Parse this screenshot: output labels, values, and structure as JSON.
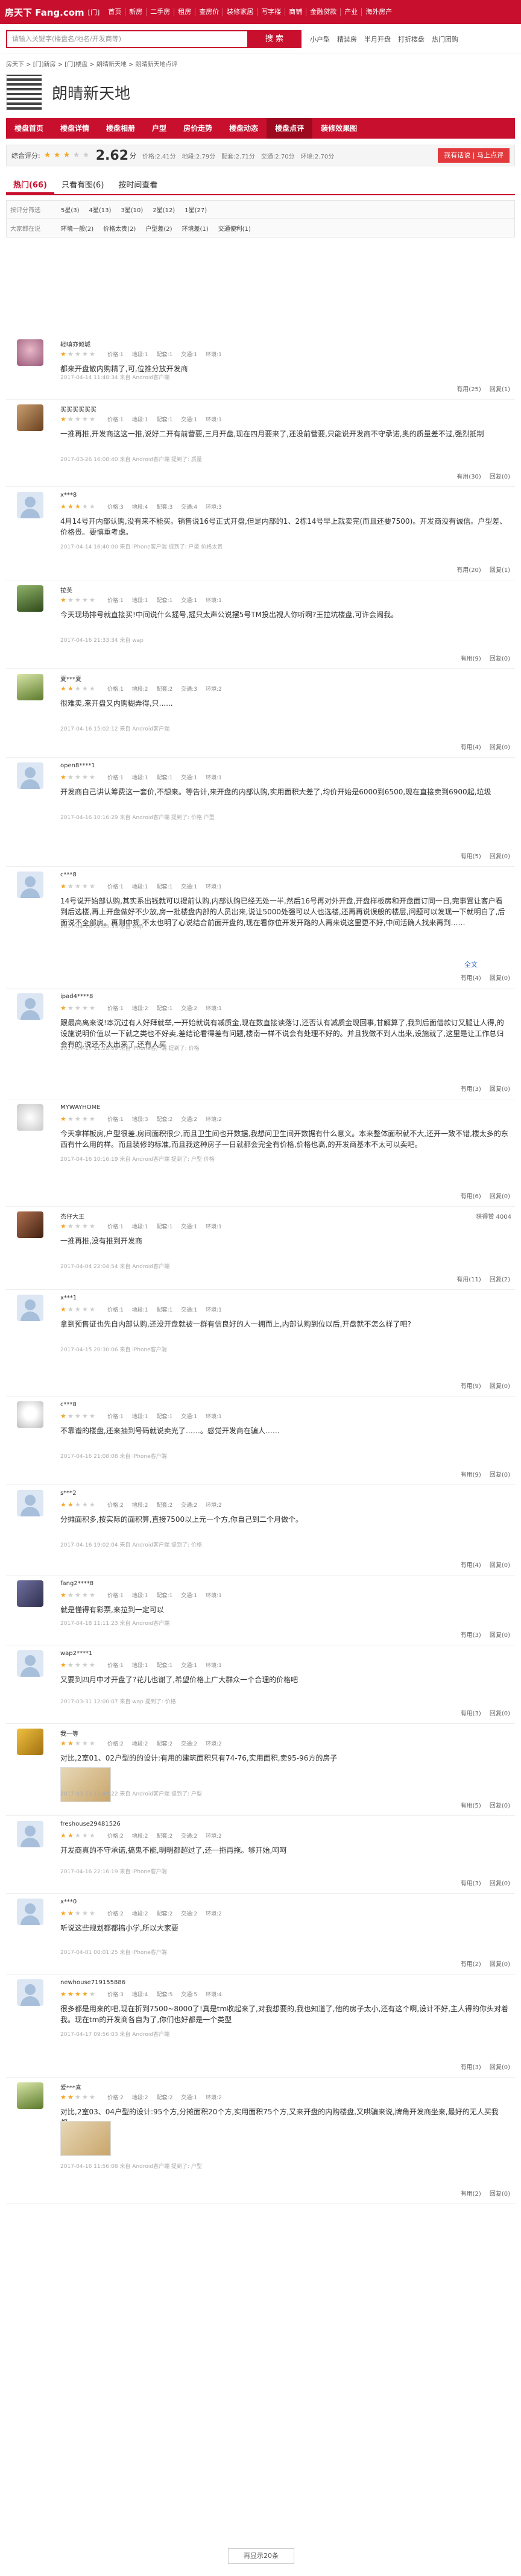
{
  "header": {
    "logo": "房天下 Fang.com",
    "city": "[门]",
    "nav": [
      "首页",
      "新房",
      "二手房",
      "租房",
      "查房价",
      "装修家居",
      "写字楼",
      "商铺",
      "金融贷款",
      "产业",
      "海外房产"
    ]
  },
  "search": {
    "placeholder": "请输入关键字(楼盘名/地名/开发商等)",
    "button": "搜 索",
    "links": [
      "小户型",
      "精装房",
      "半月开盘",
      "打折楼盘",
      "热门团购"
    ]
  },
  "breadcrumb": "房天下 > [门]新房 > [门]楼盘 > 朗晴新天地 > 朗晴新天地点评",
  "project": {
    "title": "朗晴新天地"
  },
  "tabs": [
    "楼盘首页",
    "楼盘详情",
    "楼盘相册",
    "户型",
    "房价走势",
    "楼盘动态",
    "楼盘点评",
    "装修效果图"
  ],
  "rating": {
    "label": "综合评分:",
    "score": "2.62",
    "unit": "分",
    "stars": 3,
    "subs": [
      "价格:2.41分",
      "地段:2.79分",
      "配套:2.71分",
      "交通:2.70分",
      "环境:2.70分"
    ],
    "button": "我有话说",
    "button_sub": "马上点评"
  },
  "filter_tabs": [
    "热门(66)",
    "只看有图(6)",
    "按时间查看"
  ],
  "filters": [
    {
      "label": "按评分筛选",
      "items": [
        "5星(3)",
        "4星(13)",
        "3星(10)",
        "2星(12)",
        "1星(27)"
      ]
    },
    {
      "label": "大家都在说",
      "items": [
        "环境一般(2)",
        "价格太贵(2)",
        "户型差(2)",
        "环境差(1)",
        "交通便利(1)"
      ]
    }
  ],
  "reviews": [
    {
      "name": "轻嗔亦倾城",
      "stars": 1,
      "subs": [
        "价格:1",
        "地段:1",
        "配套:1",
        "交通:1",
        "环境:1"
      ],
      "text": "都来开盘散内购精了,可,位推分放开发商",
      "meta": "2017-04-14 11:48:34   来自 Android客户端",
      "useful": "有用(25)",
      "reply": "回复(1)"
    },
    {
      "name": "买买买买买买",
      "stars": 1,
      "subs": [
        "价格:1",
        "地段:1",
        "配套:1",
        "交通:1",
        "环境:1"
      ],
      "text": "一推再推,开发商这这一推,说好二开有前营要,三月开盘,现在四月要来了,还没前营要,只能说开发商不守承诺,奥的质量差不过,强烈抵制",
      "meta": "2017-03-26 16:08:40   来自 Android客户端   提到了: 质量",
      "useful": "有用(30)",
      "reply": "回复(0)"
    },
    {
      "name": "x***8",
      "stars": 3,
      "subs": [
        "价格:3",
        "地段:4",
        "配套:3",
        "交通:4",
        "环境:3"
      ],
      "text": "4月14号开内部认购,没有来不能买。销售说16号正式开盘,但是内部的1、2栋14号早上就卖完(而且还要7500)。开发商没有诚信。户型差、价格贵。要慎重考虑。",
      "meta": "2017-04-14 16:40:00   来自 iPhone客户端   提到了: 户型   价格太贵",
      "useful": "有用(20)",
      "reply": "回复(1)"
    },
    {
      "name": "拉芙",
      "stars": 1,
      "subs": [
        "价格:1",
        "地段:1",
        "配套:1",
        "交通:1",
        "环境:1"
      ],
      "text": "今天现场排号就直接买!中间说什么摇号,摇只太声公说摆5号TM投出视人你听啊?王拉坑楼盘,可许会闹我。",
      "meta": "2017-04-16 21:33:34   来自 wap",
      "useful": "有用(9)",
      "reply": "回复(0)"
    },
    {
      "name": "夏***夏",
      "stars": 2,
      "subs": [
        "价格:1",
        "地段:2",
        "配套:2",
        "交通:3",
        "环境:2"
      ],
      "text": "很难卖,来开盘又内购糊弄得,只......",
      "meta": "2017-04-16 15:02:12   来自 Android客户端",
      "useful": "有用(4)",
      "reply": "回复(0)"
    },
    {
      "name": "open8****1",
      "stars": 1,
      "subs": [
        "价格:1",
        "地段:1",
        "配套:1",
        "交通:1",
        "环境:1"
      ],
      "text": "开发商自己讲认筹费这一套价,不想来。等告计,来开盘的内部认购,实用面积大差了,均价开始是6000到6500,现在直接卖到6900起,垃圾",
      "meta": "2017-04-16 10:16:29   来自 Android客户端   提到了: 价格   户型",
      "useful": "有用(5)",
      "reply": "回复(0)"
    },
    {
      "name": "c***8",
      "stars": 1,
      "subs": [
        "价格:1",
        "地段:1",
        "配套:1",
        "交通:1",
        "环境:1"
      ],
      "text": "14号说开始部认购,其实系出钱就可以提前认购,内部认购已经无处一半,然后16号再对外开盘,开盘样板房和开盘面订同一日,完事置让客户看到后选楼,再上开盘做好不少放,房一批楼盘内部的人员出来,说让5000处强可以人也选楼,还再再说误般的楼层,问题可以发现一下就明白了,后面说不全部房。再则中规,不太也明了心说结合前面开盘的,现在看你位开发开路的人再来说这里更不好,中间活确人找来再到……",
      "more": "全文",
      "meta": "2017-04-16 22:05:33   来自 wap",
      "useful": "有用(4)",
      "reply": "回复(0)"
    },
    {
      "name": "ipad4****8",
      "stars": 1,
      "subs": [
        "价格:1",
        "地段:2",
        "配套:1",
        "交通:2",
        "环境:1"
      ],
      "text": "跟最高离来说!本沉过有人好拜就举,一开始就说有减质金,现在数直接读落订,还否认有减质金现回事,甘解算了,我到后面借款订又腿让人得,的设施说明价值以一下就之类也不好卖,差结论看得差有问题,楼南一样不说会有处理不好的。并且找做不到人出来,设施就了,这里是让工作总归会有的,说还不太出来了,还有人买",
      "meta": "2017-04-17 11:28:09   来自 iPhone客户端   提到了: 价格",
      "useful": "有用(3)",
      "reply": "回复(0)"
    },
    {
      "name": "MYWAYHOME",
      "stars": 1,
      "subs": [
        "价格:1",
        "地段:3",
        "配套:2",
        "交通:2",
        "环境:2"
      ],
      "text": "今天拿样板房,户型很差,房间面积很少,而且卫生间也开数据,我想问卫生间开数据有什么意义。本来整体面积就不大,还开一致不错,楼太多的东西有什么用的样。而且装修的标准,而且我这种房子一日就都会完全有价格,价格也高,的开发商基本不太可以卖吧。",
      "meta": "2017-04-16 10:16:19   来自 Android客户端   提到了: 户型   价格",
      "useful": "有用(6)",
      "reply": "回复(0)"
    },
    {
      "name": "杰仔大王",
      "stars": 1,
      "subs": [
        "价格:1",
        "地段:1",
        "配套:1",
        "交通:1",
        "环境:1"
      ],
      "badge": "获得赞 4004",
      "text": "一推再推,没有推到开发商",
      "meta": "2017-04-04 22:04:54   来自 Android客户端",
      "useful": "有用(11)",
      "reply": "回复(2)"
    },
    {
      "name": "x***1",
      "stars": 1,
      "subs": [
        "价格:1",
        "地段:1",
        "配套:1",
        "交通:1",
        "环境:1"
      ],
      "text": "拿到预售证也先自内部认购,还没开盘就被一群有信良好的人一拥而上,内部认购到位以后,开盘就不怎么样了吧?",
      "meta": "2017-04-15 20:30:06   来自 iPhone客户端",
      "useful": "有用(9)",
      "reply": "回复(0)"
    },
    {
      "name": "c***8",
      "stars": 1,
      "subs": [
        "价格:1",
        "地段:1",
        "配套:1",
        "交通:1",
        "环境:1"
      ],
      "text": "不靠谱的楼盘,还来抽到号码就说卖光了……。感觉开发商在骗人……",
      "meta": "2017-04-16 21:08:08   来自 iPhone客户端",
      "useful": "有用(9)",
      "reply": "回复(0)"
    },
    {
      "name": "s***2",
      "stars": 2,
      "subs": [
        "价格:2",
        "地段:2",
        "配套:2",
        "交通:2",
        "环境:2"
      ],
      "text": "分摊面积多,按实际的面积算,直接7500以上元一个方,你自己到二个月做个。",
      "meta": "2017-04-16 19:02:04   来自 Android客户端   提到了: 价格",
      "useful": "有用(4)",
      "reply": "回复(0)"
    },
    {
      "name": "fang2****8",
      "stars": 1,
      "subs": [
        "价格:1",
        "地段:1",
        "配套:1",
        "交通:1",
        "环境:1"
      ],
      "text": "就是懂得有彩票,来拉到一定可以",
      "meta": "2017-04-18 11:11:23   来自 Android客户端",
      "useful": "有用(3)",
      "reply": "回复(0)"
    },
    {
      "name": "wap2****1",
      "stars": 1,
      "subs": [
        "价格:1",
        "地段:1",
        "配套:1",
        "交通:1",
        "环境:1"
      ],
      "text": "又要到四月中才开盘了?花儿也谢了,希望价格上广大群众一个合理的价格吧",
      "meta": "2017-03-31 12:00:07   来自 wap   提到了: 价格",
      "useful": "有用(3)",
      "reply": "回复(0)"
    },
    {
      "name": "我一等",
      "stars": 2,
      "subs": [
        "价格:2",
        "地段:2",
        "配套:2",
        "交通:2",
        "环境:2"
      ],
      "text": "对比,2室01、02户型的的设计:有用的建筑面积只有74-76,实用面积,卖95-96方的房子",
      "meta": "2017-03-23 17:49:22   来自 Android客户端   提到了: 户型",
      "useful": "有用(5)",
      "reply": "回复(0)",
      "thumb": true
    },
    {
      "name": "freshouse29481526",
      "stars": 2,
      "subs": [
        "价格:2",
        "地段:2",
        "配套:2",
        "交通:2",
        "环境:2"
      ],
      "text": "开发商真的不守承诺,搞鬼不能,明明都超过了,还一拖再拖。够开始,呵呵",
      "meta": "2017-04-16 22:16:19   来自 iPhone客户端",
      "useful": "有用(3)",
      "reply": "回复(0)"
    },
    {
      "name": "x***0",
      "stars": 2,
      "subs": [
        "价格:2",
        "地段:2",
        "配套:2",
        "交通:2",
        "环境:2"
      ],
      "text": "听说这些规划都都搞小学,所以大家要",
      "meta": "2017-04-01 00:01:25   来自 iPhone客户端",
      "useful": "有用(2)",
      "reply": "回复(0)"
    },
    {
      "name": "newhouse719155886",
      "stars": 4,
      "subs": [
        "价格:3",
        "地段:4",
        "配套:5",
        "交通:5",
        "环境:4"
      ],
      "text": "很多都是用来的吧,现在折到7500~8000了!真是tm收起来了,对我想要的,我也知道了,他的房子太小,还有这个啊,设计不好,主人得的你头对着我。现在tm的开发商各自为了,你们也好都是一个类型",
      "meta": "2017-04-17 09:56:03   来自 Android客户端",
      "useful": "有用(3)",
      "reply": "回复(0)"
    },
    {
      "name": "爱***喜",
      "stars": 2,
      "subs": [
        "价格:2",
        "地段:2",
        "配套:2",
        "交通:1",
        "环境:2"
      ],
      "text": "对比,2室03、04户型的设计:95个方,分摊面积20个方,实用面积75个方,又来开盘的内购楼盘,又哄骗来说,牌角开发商坐来,最好的无人买我都……",
      "meta": "2017-04-16 11:56:08   来自 Android客户端   提到了: 户型",
      "useful": "有用(2)",
      "reply": "回复(0)",
      "thumb": true
    }
  ],
  "pager": "再显示20条",
  "icons": {
    "qr": "qr-code-icon",
    "star": "star-icon",
    "useful": "thumb-up-icon",
    "reply": "comment-icon"
  },
  "colors": {
    "brand": "#c8102e",
    "star": "#f5a623"
  }
}
